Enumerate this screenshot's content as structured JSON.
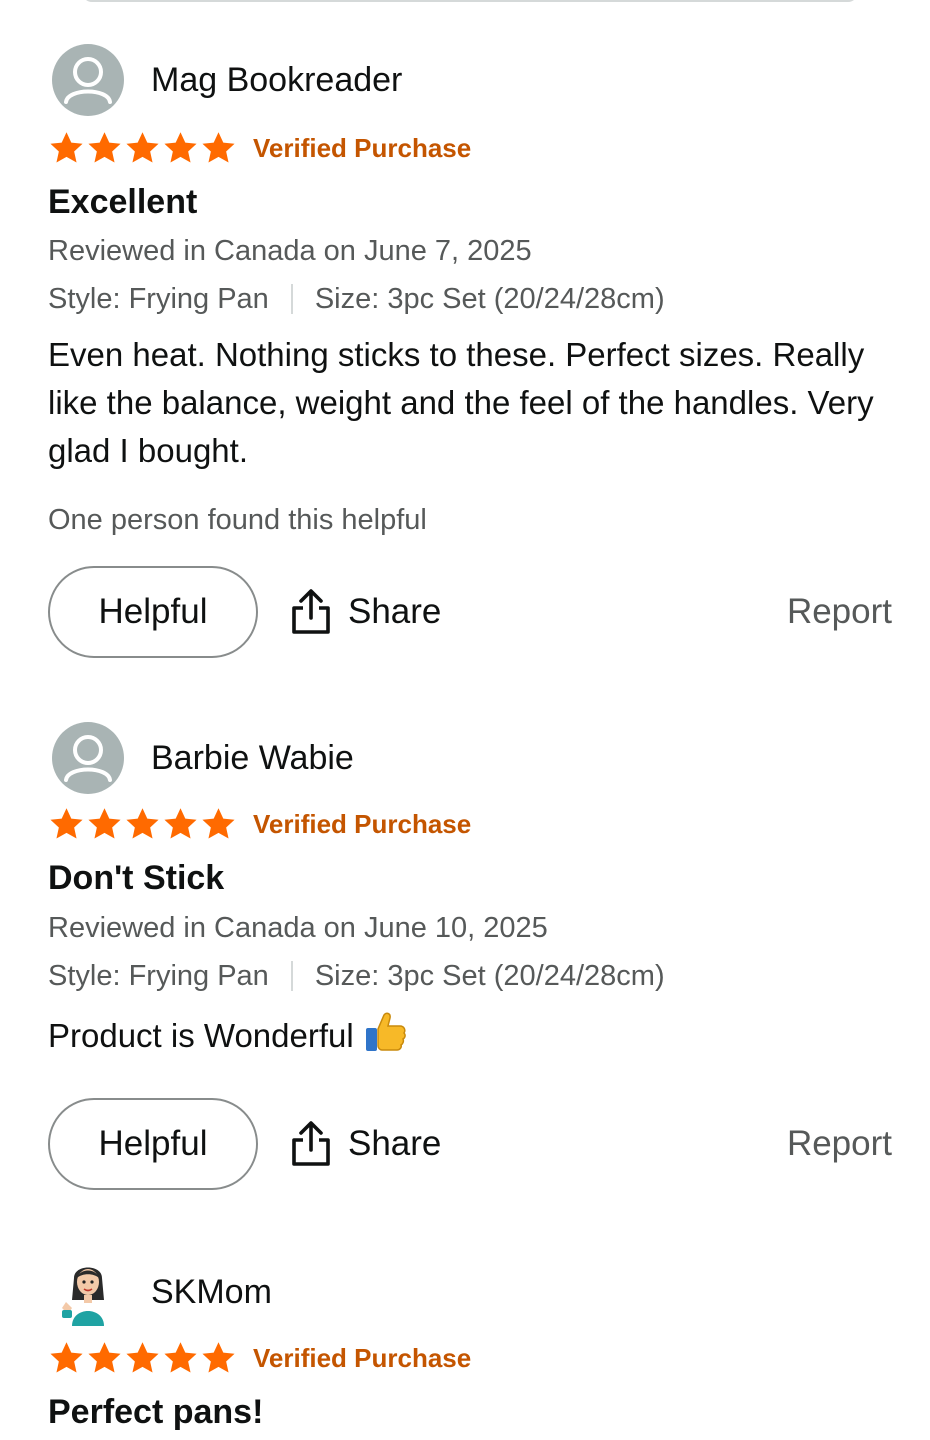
{
  "colors": {
    "star": "#ff6a00",
    "verified": "#c45500",
    "secondary_text": "#565959",
    "primary_text": "#0f1111",
    "avatar_bg": "#a9b4b4"
  },
  "reviews": [
    {
      "reviewer": "Mag Bookreader",
      "avatar": "default-avatar",
      "stars": 5,
      "verified": "Verified Purchase",
      "title": "Excellent",
      "date": "Reviewed in Canada on June 7, 2025",
      "style": "Style: Frying Pan",
      "size": "Size: 3pc Set (20/24/28cm)",
      "body": "Even heat. Nothing sticks to these. Perfect sizes. Really like the balance, weight and the feel of the handles. Very glad I bought.",
      "helpful_count": "One person found this helpful",
      "helpful_label": "Helpful",
      "share_label": "Share",
      "report_label": "Report"
    },
    {
      "reviewer": "Barbie Wabie",
      "avatar": "default-avatar",
      "stars": 5,
      "verified": "Verified Purchase",
      "title": "Don't Stick",
      "date": "Reviewed in Canada on June 10, 2025",
      "style": "Style: Frying Pan",
      "size": "Size: 3pc Set (20/24/28cm)",
      "body": "Product is Wonderful",
      "body_emoji": "thumbs-up-icon",
      "helpful_label": "Helpful",
      "share_label": "Share",
      "report_label": "Report"
    },
    {
      "reviewer": "SKMom",
      "avatar": "custom-avatar",
      "stars": 5,
      "verified": "Verified Purchase",
      "title": "Perfect pans!"
    }
  ]
}
